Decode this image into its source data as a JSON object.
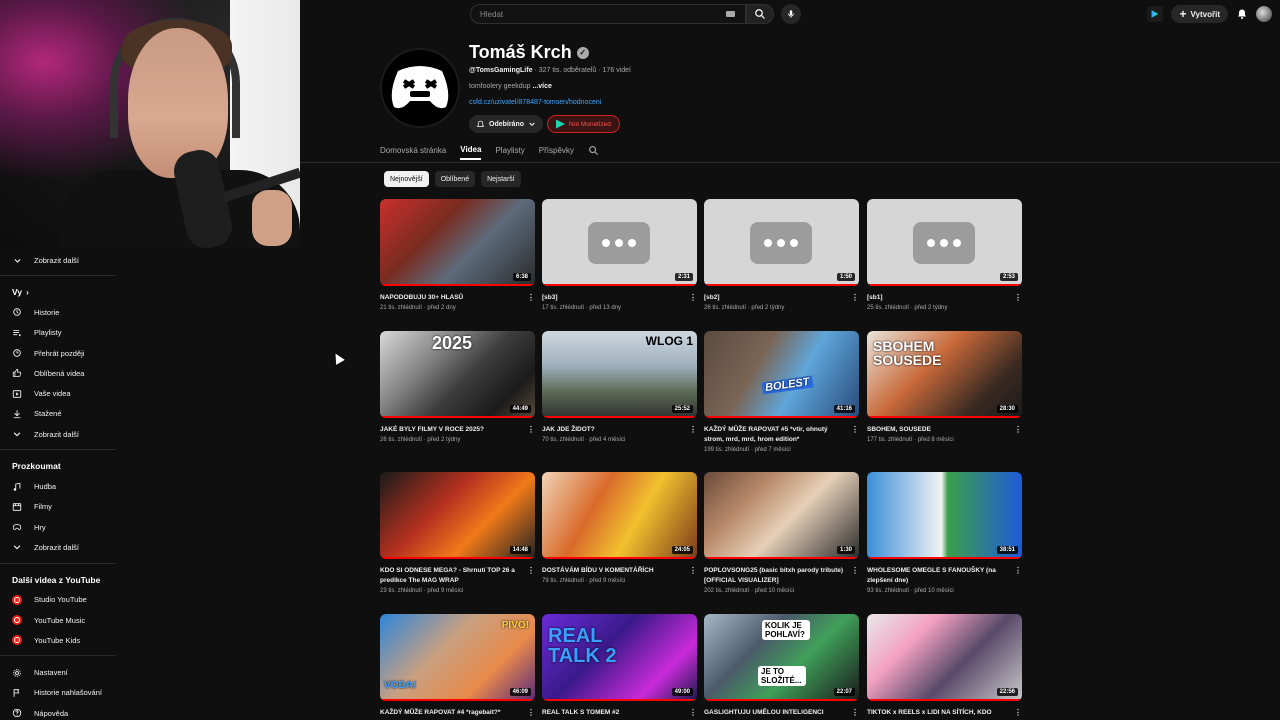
{
  "search": {
    "placeholder": "Hledat"
  },
  "topbar": {
    "create_label": "Vytvořit"
  },
  "sidebar": {
    "show_more_top": "Zobrazit další",
    "you_header": "Vy",
    "you_items": [
      {
        "label": "Historie",
        "icon": "history-icon"
      },
      {
        "label": "Playlisty",
        "icon": "playlists-icon"
      },
      {
        "label": "Přehrát později",
        "icon": "watch-later-icon"
      },
      {
        "label": "Oblíbená videa",
        "icon": "liked-icon"
      },
      {
        "label": "Vaše videa",
        "icon": "your-videos-icon"
      },
      {
        "label": "Stažené",
        "icon": "downloads-icon"
      },
      {
        "label": "Zobrazit další",
        "icon": "chevron-down-icon"
      }
    ],
    "explore_header": "Prozkoumat",
    "explore_items": [
      {
        "label": "Hudba",
        "icon": "music-icon"
      },
      {
        "label": "Filmy",
        "icon": "movies-icon"
      },
      {
        "label": "Hry",
        "icon": "gaming-icon"
      },
      {
        "label": "Zobrazit další",
        "icon": "chevron-down-icon"
      }
    ],
    "more_header": "Další videa z YouTube",
    "more_items": [
      {
        "label": "Studio YouTube"
      },
      {
        "label": "YouTube Music"
      },
      {
        "label": "YouTube Kids"
      }
    ],
    "bottom_items": [
      {
        "label": "Nastavení",
        "icon": "settings-icon"
      },
      {
        "label": "Historie nahlašování",
        "icon": "flag-icon"
      },
      {
        "label": "Nápověda",
        "icon": "help-icon"
      }
    ]
  },
  "channel": {
    "name": "Tomáš Krch",
    "handle": "@TomsGamingLife",
    "subs": "· 327 tis. odběratelů · 176 videí",
    "desc": "tomfoolery geekdup ",
    "desc_more": "...více",
    "link": "csfd.cz/uzivatel/878487-tomsen/hodnoceni",
    "subscribed_label": "Odebíráno",
    "not_monetized_label": "Not Monetized"
  },
  "tabs": [
    "Domovská stránka",
    "Videa",
    "Playlisty",
    "Příspěvky"
  ],
  "chips": [
    "Nejnovější",
    "Oblíbené",
    "Nejstarší"
  ],
  "videos": [
    {
      "title": "NAPODOBUJU 30+ HLASŮ",
      "meta": "21 tis. zhlédnutí · před 2 dny",
      "dur": "6:38"
    },
    {
      "title": "[sb3]",
      "meta": "17 tis. zhlédnutí · před 13 dny",
      "dur": "2:31"
    },
    {
      "title": "[sb2]",
      "meta": "26 tis. zhlédnutí · před 2 týdny",
      "dur": "1:50"
    },
    {
      "title": "[sb1]",
      "meta": "25 tis. zhlédnutí · před 2 týdny",
      "dur": "2:53"
    },
    {
      "title": "JAKÉ BYLY FILMY V ROCE 2025?",
      "meta": "26 tis. zhlédnutí · před 2 týdny",
      "dur": "44:49"
    },
    {
      "title": "JAK JDE ŽIDOT?",
      "meta": "70 tis. zhlédnutí · před 4 měsíci",
      "dur": "25:52"
    },
    {
      "title": "KAŽDÝ MŮŽE RAPOVAT #5 *vtir, ohnutý strom, mrd, mrd, hrom edition*",
      "meta": "199 tis. zhlédnutí · před 7 měsíci",
      "dur": "41:16"
    },
    {
      "title": "SBOHEM, SOUSEDE",
      "meta": "177 tis. zhlédnutí · před 8 měsíci",
      "dur": "28:30"
    },
    {
      "title": "KDO SI ODNESE MEGA? - Shrnutí TOP 26 a predikce The MAG WRAP",
      "meta": "23 tis. zhlédnutí · před 9 měsíci",
      "dur": "14:48"
    },
    {
      "title": "DOSTÁVÁM BÍDU V KOMENTÁŘÍCH",
      "meta": "79 tis. zhlédnutí · před 9 měsíci",
      "dur": "24:05"
    },
    {
      "title": "POPLOVSONG25 (basic bitxh parody tribute) [OFFICIAL VISUALIZER]",
      "meta": "202 tis. zhlédnutí · před 10 měsíci",
      "dur": "1:30"
    },
    {
      "title": "WHOLESOME OMEGLE S FANOUŠKY (na zlepšení dne)",
      "meta": "93 tis. zhlédnutí · před 10 měsíci",
      "dur": "38:51"
    },
    {
      "title": "KAŽDÝ MŮŽE RAPOVAT #4 *ragebait?*",
      "meta": "",
      "dur": "46:09"
    },
    {
      "title": "REAL TALK S TOMEM #2",
      "meta": "",
      "dur": "49:00"
    },
    {
      "title": "GASLIGHTUJU UMĚLOU INTELIGENCI",
      "meta": "",
      "dur": "22:07"
    },
    {
      "title": "TIKTOK x REELS x LIDI NA SÍTÍCH, KDO",
      "meta": "",
      "dur": "22:56"
    }
  ],
  "thumb_text": {
    "t5": "2025",
    "t6": "WLOG 1",
    "t7": "BOLEST",
    "t8": "SBOHEM SOUSEDE",
    "t13_a": "PIVO!",
    "t13_b": "VODA!",
    "t14": "REAL TALK 2",
    "t15_a": "KOLIK JE POHLAVÍ?",
    "t15_b": "JE TO SLOŽITÉ..."
  }
}
